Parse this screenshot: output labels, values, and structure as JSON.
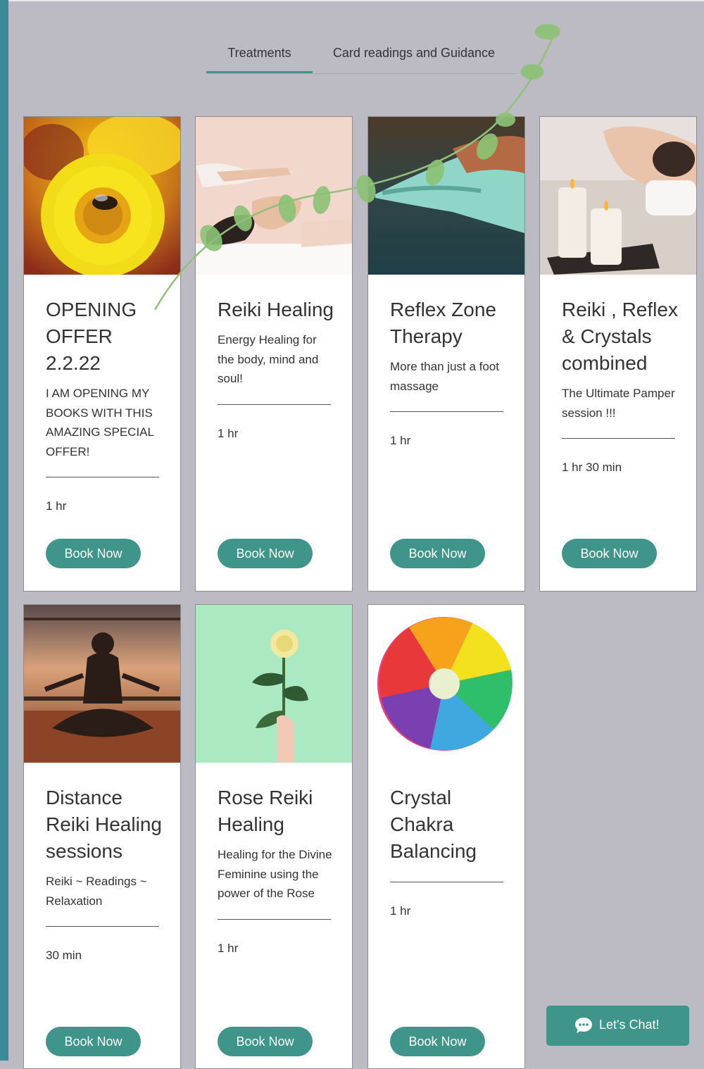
{
  "tabs": [
    {
      "label": "Treatments",
      "active": true
    },
    {
      "label": "Card readings and Guidance",
      "active": false
    }
  ],
  "services": [
    {
      "title": "OPENING OFFER 2.2.22",
      "description": "I AM OPENING MY BOOKS WITH THIS AMAZING SPECIAL OFFER!",
      "duration": "1 hr",
      "button": "Book Now",
      "image": "yellow-flower-with-bee"
    },
    {
      "title": "Reiki Healing",
      "description": "Energy Healing for the body, mind and soul!",
      "duration": "1 hr",
      "button": "Book Now",
      "image": "reiki-hands-over-face"
    },
    {
      "title": "Reflex Zone Therapy",
      "description": "More than just a foot massage",
      "duration": "1 hr",
      "button": "Book Now",
      "image": "foot-massage"
    },
    {
      "title": "Reiki , Reflex & Crystals combined",
      "description": "The Ultimate Pamper session !!!",
      "duration": "1 hr 30 min",
      "button": "Book Now",
      "image": "spa-candles-massage"
    },
    {
      "title": "Distance Reiki Healing sessions",
      "description": "Reiki ~ Readings ~ Relaxation",
      "duration": "30 min",
      "button": "Book Now",
      "image": "meditation-silhouette-sunset"
    },
    {
      "title": "Rose Reiki Healing",
      "description": "Healing for the Divine Feminine using the power of the Rose",
      "duration": "1 hr",
      "button": "Book Now",
      "image": "yellow-rose-in-hand"
    },
    {
      "title": "Crystal Chakra Balancing",
      "description": "",
      "duration": "1 hr",
      "button": "Book Now",
      "image": "rainbow-chrysanthemum"
    }
  ],
  "chat": {
    "label": "Let's Chat!",
    "icon": "chat-bubble-icon"
  },
  "colors": {
    "accent": "#3f9589",
    "page_background": "#bcbac2",
    "left_bar": "#3a8b98"
  }
}
